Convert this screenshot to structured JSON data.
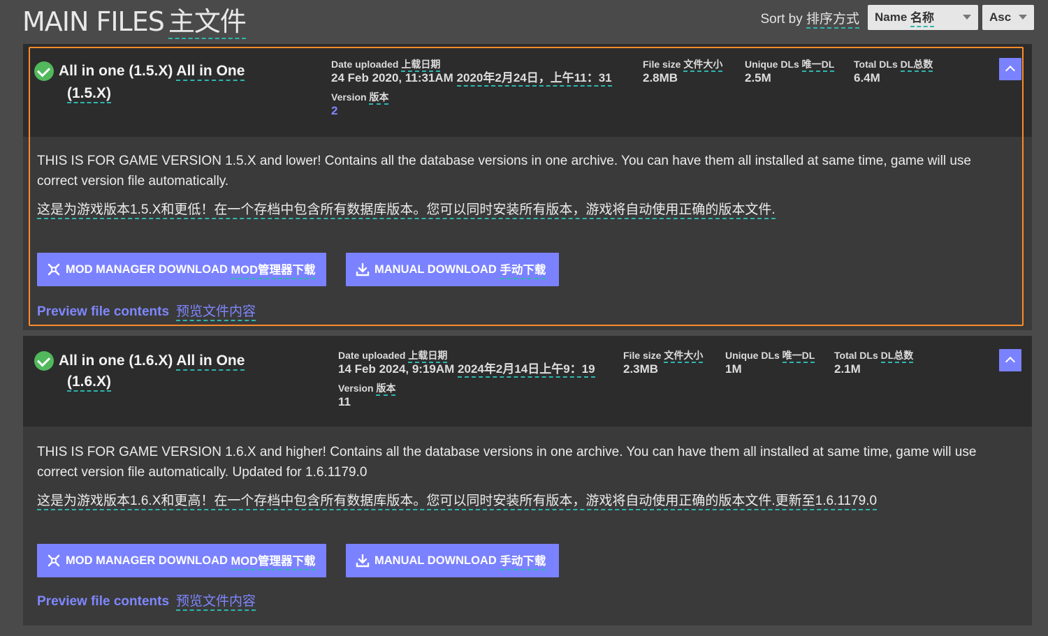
{
  "header": {
    "title": "MAIN FILES",
    "title_zh": "主文件",
    "sort_label": "Sort by",
    "sort_label_zh": "排序方式",
    "sort_value": "Name",
    "sort_value_zh": "名称",
    "order_value": "Asc"
  },
  "files": [
    {
      "name": "All in one (1.5.X)",
      "name_zh_1": "All in One",
      "name_zh_2": "(1.5.X)",
      "date_label": "Date uploaded",
      "date_label_zh": "上载日期",
      "date_value": "24 Feb 2020, 11:31AM",
      "date_value_zh": "2020年2月24日，上午11：31",
      "version_label": "Version",
      "version_label_zh": "版本",
      "version_value": "2",
      "size_label": "File size",
      "size_label_zh": "文件大小",
      "size_value": "2.8MB",
      "unique_label": "Unique DLs",
      "unique_label_zh": "唯一DL",
      "unique_value": "2.5M",
      "total_label": "Total DLs",
      "total_label_zh": "DL总数",
      "total_value": "6.4M",
      "desc": "THIS IS FOR GAME VERSION 1.5.X and lower! Contains all the database versions in one archive. You can have them all installed at same time, game will use correct version file automatically.",
      "desc_zh": "这是为游戏版本1.5.X和更低！在一个存档中包含所有数据库版本。您可以同时安装所有版本，游戏将自动使用正确的版本文件.",
      "mod_manager_label": "MOD MANAGER DOWNLOAD",
      "mod_manager_label_zh": "MOD管理器下载",
      "manual_label": "MANUAL DOWNLOAD",
      "manual_label_zh": "手动下载",
      "preview_label": "Preview file contents",
      "preview_label_zh": "预览文件内容"
    },
    {
      "name": "All in one (1.6.X)",
      "name_zh_1": "All in One",
      "name_zh_2": "(1.6.X)",
      "date_label": "Date uploaded",
      "date_label_zh": "上载日期",
      "date_value": "14 Feb 2024, 9:19AM",
      "date_value_zh": "2024年2月14日上午9：19",
      "version_label": "Version",
      "version_label_zh": "版本",
      "version_value": "11",
      "size_label": "File size",
      "size_label_zh": "文件大小",
      "size_value": "2.3MB",
      "unique_label": "Unique DLs",
      "unique_label_zh": "唯一DL",
      "unique_value": "1M",
      "total_label": "Total DLs",
      "total_label_zh": "DL总数",
      "total_value": "2.1M",
      "desc": "THIS IS FOR GAME VERSION 1.6.X and higher! Contains all the database versions in one archive. You can have them all installed at same time, game will use correct version file automatically. Updated for 1.6.1179.0",
      "desc_zh": "这是为游戏版本1.6.X和更高！在一个存档中包含所有数据库版本。您可以同时安装所有版本，游戏将自动使用正确的版本文件.更新至1.6.1179.0",
      "mod_manager_label": "MOD MANAGER DOWNLOAD",
      "mod_manager_label_zh": "MOD管理器下载",
      "manual_label": "MANUAL DOWNLOAD",
      "manual_label_zh": "手动下载",
      "preview_label": "Preview file contents",
      "preview_label_zh": "预览文件内容"
    }
  ],
  "colors": {
    "accent": "#7b82ff",
    "selected_outline": "#ff8a2a",
    "success": "#52b85c",
    "translation_underline": "#2fb6b0"
  },
  "icons": [
    "check-circle-icon",
    "chevron-up-icon",
    "mod-manager-icon",
    "download-icon",
    "dropdown-caret-icon"
  ]
}
